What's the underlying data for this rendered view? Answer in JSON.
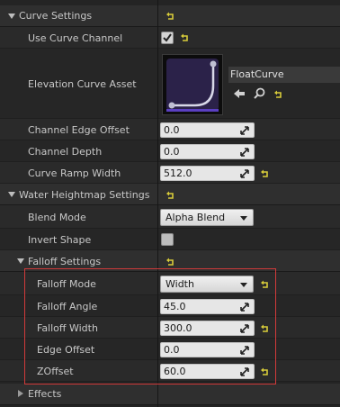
{
  "colors": {
    "reset_arrow": "#d8cc3a",
    "highlight_border": "#d23a3a"
  },
  "curve_settings": {
    "header": "Curve Settings",
    "use_curve_channel": {
      "label": "Use Curve Channel",
      "checked": true
    },
    "elevation_curve_asset": {
      "label": "Elevation Curve Asset",
      "asset_name": "FloatCurve",
      "icons": [
        "use-selected-arrow-icon",
        "browse-search-icon"
      ]
    },
    "channel_edge_offset": {
      "label": "Channel Edge Offset",
      "value": "0.0"
    },
    "channel_depth": {
      "label": "Channel Depth",
      "value": "0.0"
    },
    "curve_ramp_width": {
      "label": "Curve Ramp Width",
      "value": "512.0"
    }
  },
  "water_heightmap_settings": {
    "header": "Water Heightmap Settings",
    "blend_mode": {
      "label": "Blend Mode",
      "value": "Alpha Blend"
    },
    "invert_shape": {
      "label": "Invert Shape",
      "checked": false
    },
    "falloff_settings": {
      "header": "Falloff Settings",
      "falloff_mode": {
        "label": "Falloff Mode",
        "value": "Width"
      },
      "falloff_angle": {
        "label": "Falloff Angle",
        "value": "45.0"
      },
      "falloff_width": {
        "label": "Falloff Width",
        "value": "300.0"
      },
      "edge_offset": {
        "label": "Edge Offset",
        "value": "0.0"
      },
      "zoffset": {
        "label": "ZOffset",
        "value": "60.0"
      }
    }
  },
  "effects": {
    "header": "Effects",
    "expanded": false
  }
}
